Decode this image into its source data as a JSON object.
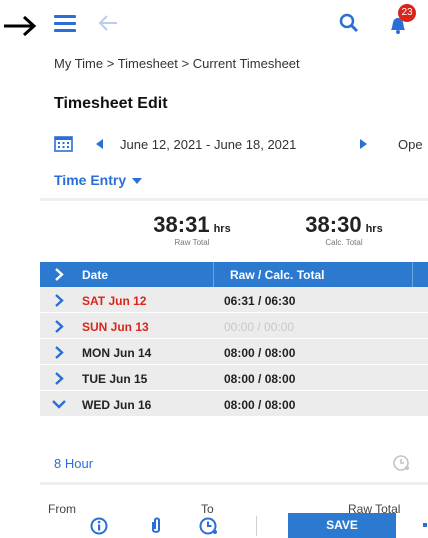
{
  "header": {
    "notification_count": "23"
  },
  "breadcrumb": "My Time > Timesheet > Current Timesheet",
  "page_title": "Timesheet Edit",
  "period": {
    "range": "June 12, 2021 - June 18, 2021",
    "status": "Ope"
  },
  "time_entry_label": "Time Entry",
  "totals": {
    "raw_value": "38:31",
    "raw_unit": "hrs",
    "raw_caption": "Raw Total",
    "calc_value": "38:30",
    "calc_unit": "hrs",
    "calc_caption": "Calc. Total"
  },
  "table": {
    "headers": [
      "Date",
      "Raw / Calc. Total"
    ],
    "rows": [
      {
        "date": "SAT Jun 12",
        "total": "06:31 / 06:30"
      },
      {
        "date": "SUN Jun 13",
        "total": "00:00 / 00:00"
      },
      {
        "date": "MON Jun 14",
        "total": "08:00 / 08:00"
      },
      {
        "date": "TUE Jun 15",
        "total": "08:00 / 08:00"
      },
      {
        "date": "WED Jun 16",
        "total": "08:00 / 08:00"
      }
    ]
  },
  "entry": {
    "label": "8 Hour",
    "columns": [
      "From",
      "To",
      "Raw Total"
    ]
  },
  "toolbar": {
    "save_label": "SAVE"
  },
  "colors": {
    "accent": "#2b7ad0",
    "weekend_red": "#d9261c",
    "row_bg": "#ececec"
  },
  "icons": [
    "annotation-arrow-icon",
    "hamburger-menu-icon",
    "back-arrow-icon",
    "search-icon",
    "bell-icon",
    "calendar-icon",
    "chevron-right-icon",
    "chevron-down-icon",
    "clock-icon",
    "info-icon",
    "paperclip-icon"
  ]
}
